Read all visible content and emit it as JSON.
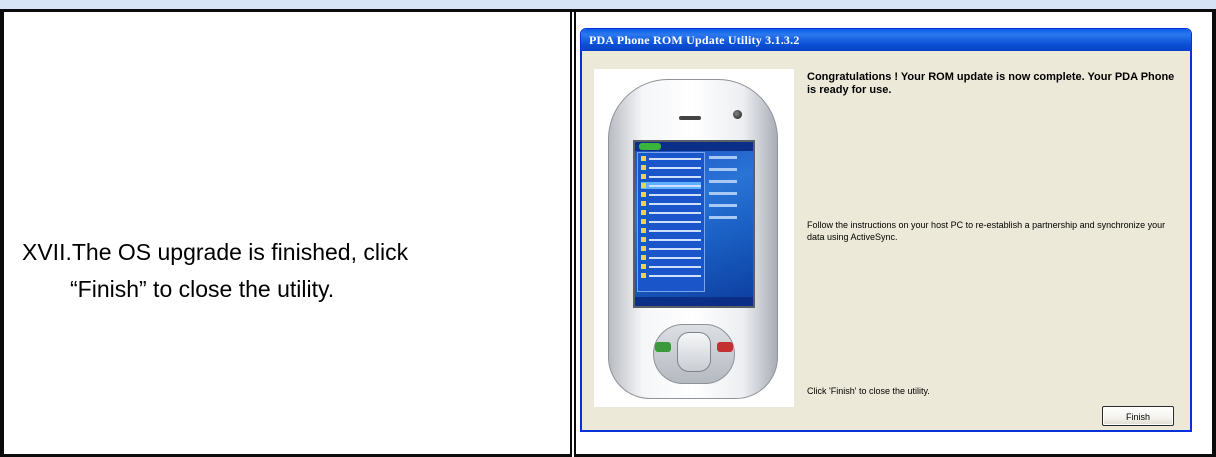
{
  "document": {
    "step_text_line1": "XVII.The OS upgrade is finished, click",
    "step_text_line2": "“Finish” to close the utility."
  },
  "window": {
    "title": "PDA Phone ROM Update Utility 3.1.3.2",
    "congrats_text": "Congratulations ! Your ROM update is now complete. Your PDA Phone is ready for use.",
    "follow_text": "Follow the instructions on your host PC to re-establish a partnership and synchronize your data using ActiveSync.",
    "click_finish_text": "Click 'Finish' to close the utility.",
    "finish_label": "Finish"
  },
  "colors": {
    "header_band": "#d6e3f7",
    "titlebar": "#0b4fd6",
    "window_bg": "#ece9d8"
  }
}
